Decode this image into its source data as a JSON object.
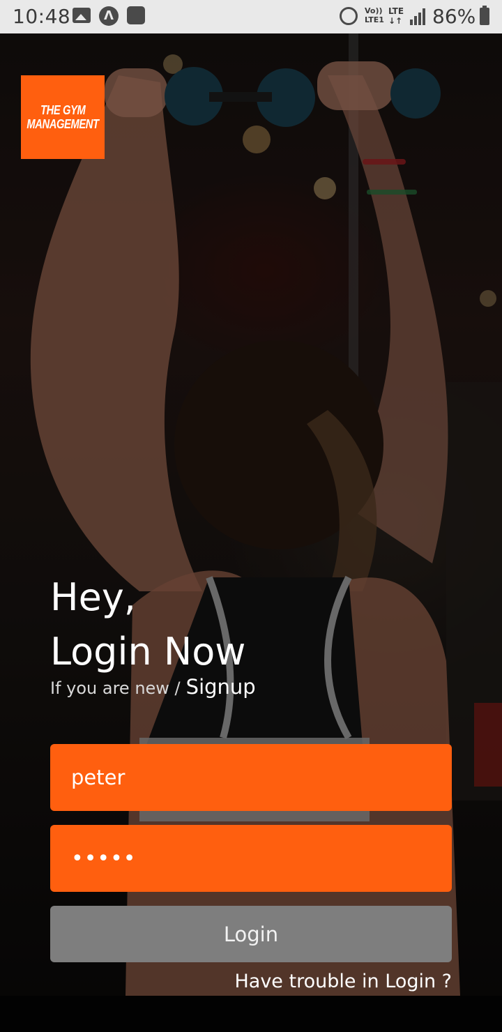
{
  "status_bar": {
    "time": "10:48",
    "battery": "86%",
    "volte_line1": "Vo))",
    "volte_line2": "LTE1",
    "lte_line1": "LTE",
    "lte_line2": "↓↑",
    "icons": [
      "gallery-icon",
      "app-a-icon",
      "wifi-icon",
      "alarm-icon",
      "volte-icon",
      "lte-icon",
      "signal-icon",
      "battery-icon"
    ]
  },
  "logo": {
    "line1": "THE GYM",
    "line2": "MANAGEMENT"
  },
  "headline": {
    "line1": "Hey,",
    "line2": "Login Now"
  },
  "signup": {
    "prompt": "If you are new /",
    "link": "Signup"
  },
  "form": {
    "username_value": "peter",
    "password_value": "•••••"
  },
  "login_button": "Login",
  "trouble_link": "Have trouble in Login ?",
  "colors": {
    "accent": "#ff5f0f",
    "button_gray": "#7e7e7e",
    "status_bar_bg": "#e9e9e9"
  }
}
